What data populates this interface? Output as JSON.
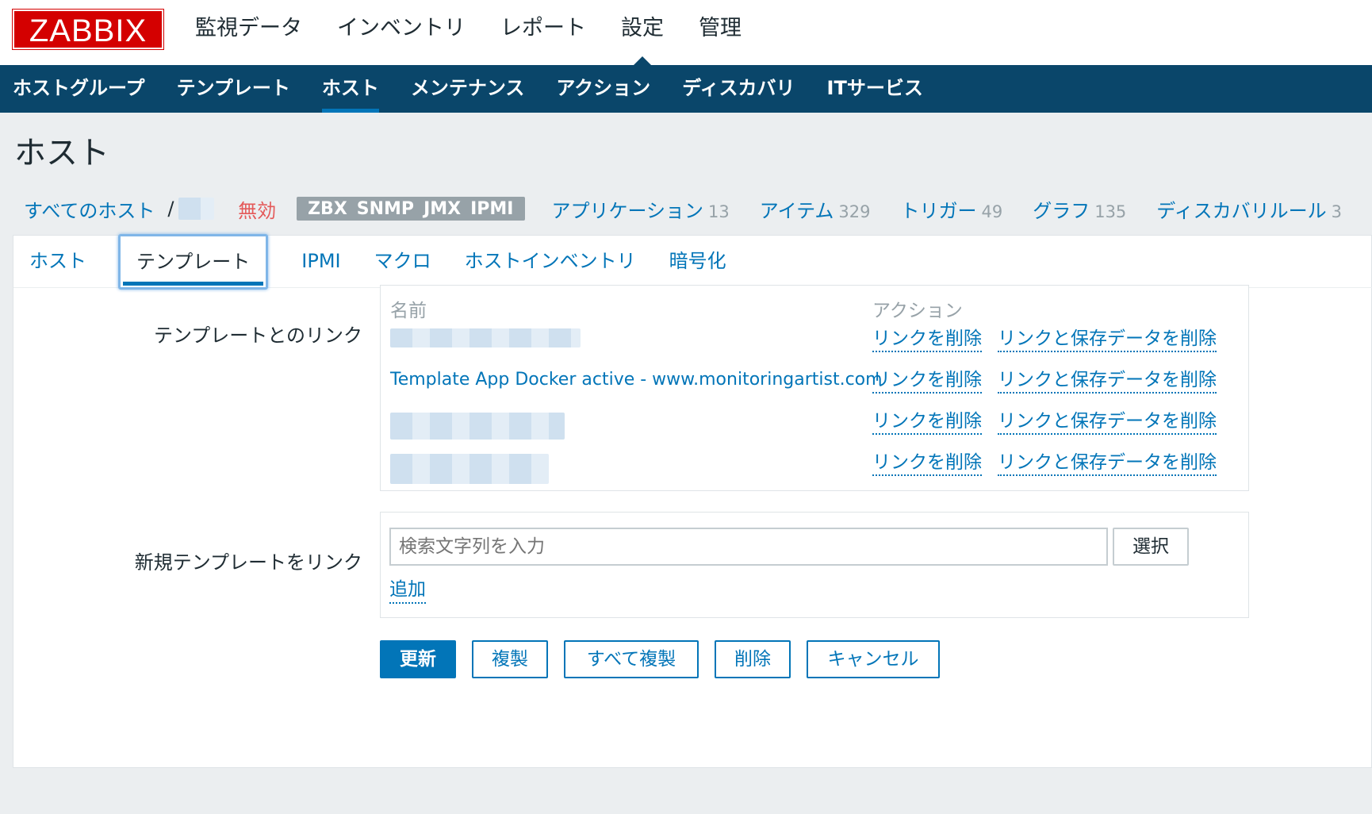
{
  "logo": "ZABBIX",
  "main_nav": [
    "監視データ",
    "インベントリ",
    "レポート",
    "設定",
    "管理"
  ],
  "main_nav_active": "設定",
  "sub_nav": [
    "ホストグループ",
    "テンプレート",
    "ホスト",
    "メンテナンス",
    "アクション",
    "ディスカバリ",
    "ITサービス"
  ],
  "sub_nav_active": "ホスト",
  "page_title": "ホスト",
  "breadcrumb": {
    "all_hosts": "すべてのホスト",
    "separator": "/",
    "status": "無効",
    "availability": [
      "ZBX",
      "SNMP",
      "JMX",
      "IPMI"
    ],
    "items": [
      {
        "label": "アプリケーション",
        "count": "13"
      },
      {
        "label": "アイテム",
        "count": "329"
      },
      {
        "label": "トリガー",
        "count": "49"
      },
      {
        "label": "グラフ",
        "count": "135"
      },
      {
        "label": "ディスカバリルール",
        "count": "3"
      }
    ]
  },
  "tabs": [
    "ホスト",
    "テンプレート",
    "IPMI",
    "マクロ",
    "ホストインベントリ",
    "暗号化"
  ],
  "tabs_active": "テンプレート",
  "linked_templates": {
    "label": "テンプレートとのリンク",
    "col_name": "名前",
    "col_action": "アクション",
    "rows": [
      {
        "name": "",
        "unlink": "リンクを削除",
        "unlink_clear": "リンクと保存データを削除"
      },
      {
        "name": "Template App Docker active - www.monitoringartist.com",
        "unlink": "リンクを削除",
        "unlink_clear": "リンクと保存データを削除"
      },
      {
        "name": "",
        "unlink": "リンクを削除",
        "unlink_clear": "リンクと保存データを削除"
      },
      {
        "name": "",
        "unlink": "リンクを削除",
        "unlink_clear": "リンクと保存データを削除"
      }
    ]
  },
  "new_template": {
    "label": "新規テンプレートをリンク",
    "search_placeholder": "検索文字列を入力",
    "select_button": "選択",
    "add_link": "追加"
  },
  "buttons": {
    "update": "更新",
    "clone": "複製",
    "full_clone": "すべて複製",
    "delete": "削除",
    "cancel": "キャンセル"
  },
  "colors": {
    "brand_red": "#d40000",
    "nav_blue": "#0a466a",
    "link_blue": "#0275b8",
    "disabled_red": "#e45959",
    "availability_gray": "#97a2a8"
  }
}
